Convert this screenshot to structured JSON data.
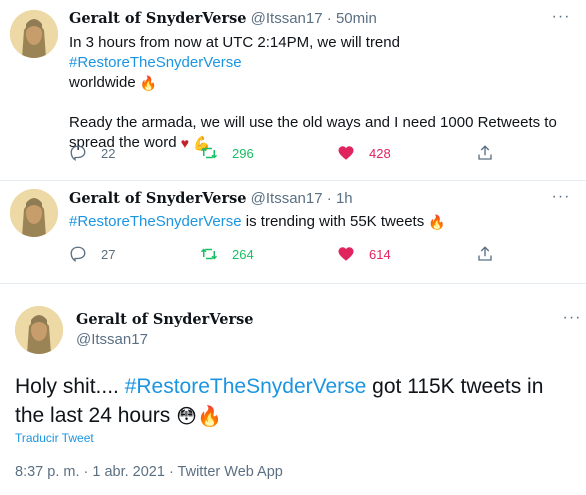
{
  "tweets": [
    {
      "author_name": "Geralt of SnyderVerse",
      "handle": "@Itssan17",
      "separator": "·",
      "time": "50min",
      "line1_pre": "In 3 hours from now at UTC 2:14PM, we will trend ",
      "hashtag": "#RestoreTheSnyderVerse",
      "line2": "worldwide",
      "line3": "Ready the armada, we will use the old ways and I need 1000 Retweets to",
      "line4": "spread the word",
      "replies": "22",
      "retweets": "296",
      "likes": "428"
    },
    {
      "author_name": "Geralt of SnyderVerse",
      "handle": "@Itssan17",
      "separator": "·",
      "time": "1h",
      "hashtag": "#RestoreTheSnyderVerse",
      "text_post": " is trending with 55K tweets",
      "replies": "27",
      "retweets": "264",
      "likes": "614"
    }
  ],
  "main_tweet": {
    "author_name": "Geralt of SnyderVerse",
    "handle": "@Itssan17",
    "text_pre": "Holy shit.... ",
    "hashtag": "#RestoreTheSnyderVerse",
    "text_post": " got 115K tweets in",
    "text_line2": "the last 24 hours ",
    "translate_label": "Traducir Tweet",
    "timestamp_line": "8:37 p. m. · 1 abr. 2021 · Twitter Web App"
  },
  "more_label": "···",
  "icons": {
    "more": "more-horizontal-icon",
    "reply": "reply-icon",
    "retweet": "retweet-icon",
    "like": "heart-icon",
    "share": "share-icon",
    "fire": "fire-emoji",
    "heart_emoji": "red-heart-emoji",
    "muscle": "flexed-biceps-emoji",
    "flushed": "flushed-face-emoji"
  },
  "colors": {
    "link": "#1b95e0",
    "secondary_text": "#5b7083",
    "retweet_green": "#17bf63",
    "like_red": "#e0245e"
  }
}
